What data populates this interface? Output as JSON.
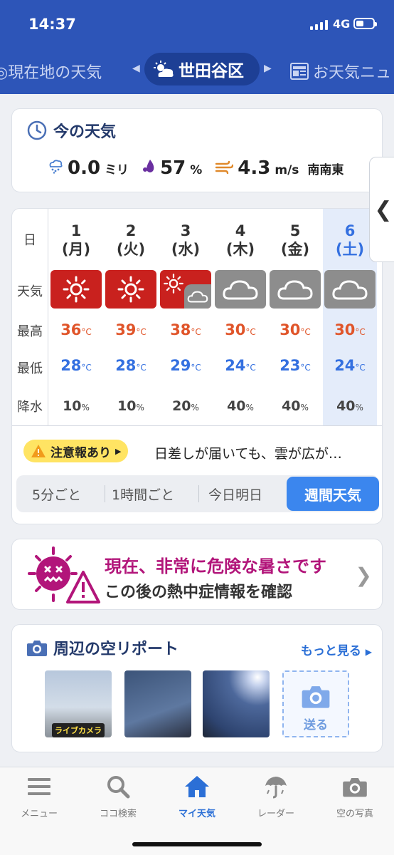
{
  "status": {
    "time": "14:37",
    "network": "4G"
  },
  "tabs": {
    "left": "現在地の天気",
    "active": "世田谷区",
    "right": "お天気ニュ"
  },
  "now": {
    "title": "今の天気",
    "rain": "0.0",
    "rain_unit": "ミリ",
    "humidity": "57",
    "humidity_unit": "%",
    "wind": "4.3",
    "wind_unit": "m/s",
    "wind_dir": "南南東"
  },
  "week": {
    "row_labels": {
      "day": "日",
      "weather": "天気",
      "high": "最高",
      "low": "最低",
      "precip": "降水"
    },
    "temp_unit": "°C",
    "precip_unit": "%",
    "days": [
      {
        "date": "1",
        "weekday": "(月)",
        "weather": "sunny",
        "high": "36",
        "low": "28",
        "precip": "10"
      },
      {
        "date": "2",
        "weekday": "(火)",
        "weather": "sunny",
        "high": "39",
        "low": "28",
        "precip": "10"
      },
      {
        "date": "3",
        "weekday": "(水)",
        "weather": "sunny-cloudy",
        "high": "38",
        "low": "29",
        "precip": "20"
      },
      {
        "date": "4",
        "weekday": "(木)",
        "weather": "cloudy",
        "high": "30",
        "low": "24",
        "precip": "40"
      },
      {
        "date": "5",
        "weekday": "(金)",
        "weather": "cloudy",
        "high": "30",
        "low": "23",
        "precip": "40"
      },
      {
        "date": "6",
        "weekday": "(土)",
        "weather": "cloudy",
        "high": "30",
        "low": "24",
        "precip": "40"
      }
    ],
    "warning_badge": "注意報あり",
    "warning_text": "日差しが届いても、雲が広が…",
    "segments": [
      "5分ごと",
      "1時間ごと",
      "今日明日",
      "週間天気"
    ]
  },
  "heat": {
    "line1": "現在、非常に危険な暑さです",
    "line2": "この後の熱中症情報を確認"
  },
  "photos": {
    "title": "周辺の空リポート",
    "more": "もっと見る",
    "live_label": "ライブカメラ",
    "send_label": "送る"
  },
  "nav": [
    "メニュー",
    "ココ検索",
    "マイ天気",
    "レーダー",
    "空の写真"
  ],
  "colors": {
    "header": "#2d55b8",
    "sunny": "#c9211e",
    "cloudy": "#8d8d8d",
    "high": "#e0552a",
    "low": "#3470e0",
    "accent": "#3b86ee",
    "heat": "#b2157a"
  }
}
